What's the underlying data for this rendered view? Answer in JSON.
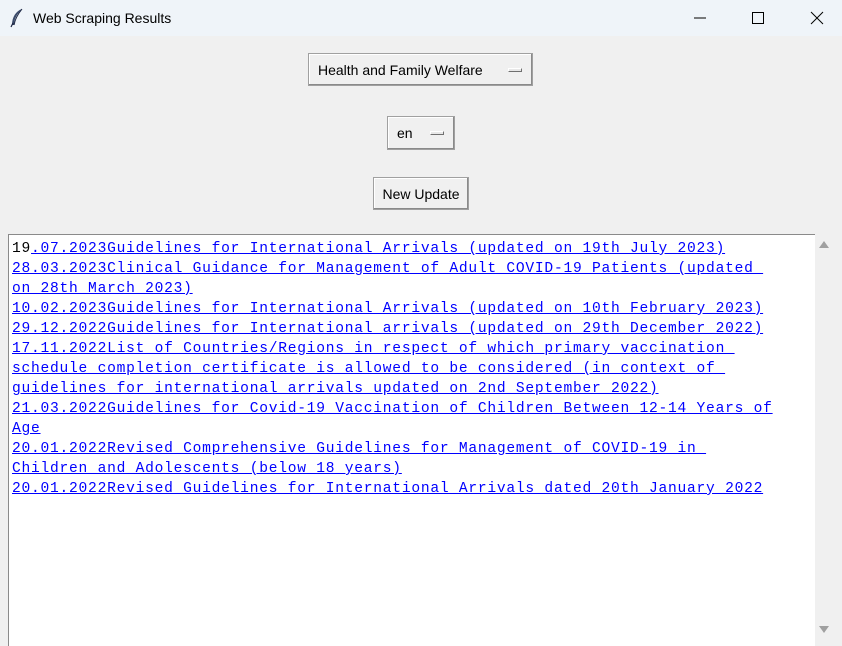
{
  "window": {
    "title": "Web Scraping Results",
    "app_icon": "feather-icon",
    "controls": {
      "minimize_icon": "minimize-icon",
      "maximize_icon": "maximize-icon",
      "close_icon": "close-icon"
    }
  },
  "controls": {
    "department": "Health and Family Welfare",
    "language": "en",
    "update_label": "New Update"
  },
  "results": {
    "first_lead": "19",
    "lines": [
      ".07.2023Guidelines for International Arrivals (updated on 19th July 2023)",
      "28.03.2023Clinical Guidance for Management of Adult COVID-19 Patients (updated ",
      "on 28th March 2023)",
      "10.02.2023Guidelines for International Arrivals (updated on 10th February 2023)",
      "29.12.2022Guidelines for International arrivals (updated on 29th December 2022)",
      "17.11.2022List of Countries/Regions in respect of which primary vaccination ",
      "schedule completion certificate is allowed to be considered (in context of ",
      "guidelines for international arrivals updated on 2nd September 2022)",
      "21.03.2022Guidelines for Covid-19 Vaccination of Children Between 12-14 Years of",
      "Age",
      "20.01.2022Revised Comprehensive Guidelines for Management of COVID-19 in ",
      "Children and Adolescents (below 18 years)",
      "20.01.2022Revised Guidelines for International Arrivals dated 20th January 2022"
    ]
  },
  "colors": {
    "link": "#0000ff",
    "background": "#f0f0f0",
    "titlebar": "#eff4f9"
  }
}
